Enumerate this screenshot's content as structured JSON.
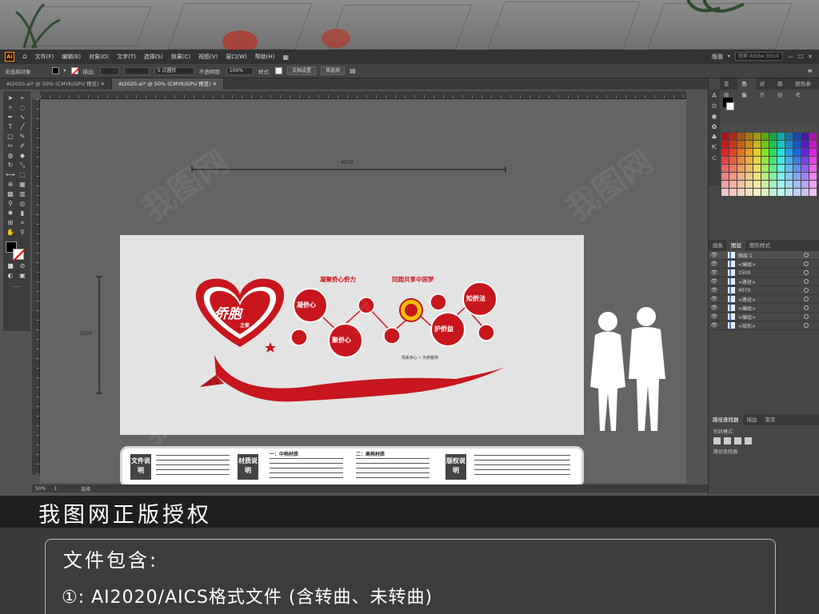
{
  "app": {
    "logo": "Ai",
    "menu": [
      "文件(F)",
      "编辑(E)",
      "对象(O)",
      "文字(T)",
      "选择(S)",
      "效果(C)",
      "视图(V)",
      "窗口(W)",
      "帮助(H)"
    ],
    "workspace": "版面",
    "search_placeholder": "搜索 Adobe Stock"
  },
  "control_bar": {
    "selection_label": "未选择对象",
    "stroke_label": "描边:",
    "brush_value": "5 点圆形",
    "opacity_label": "不透明度:",
    "opacity_value": "100%",
    "style_label": "样式:",
    "doc_setup_button": "文档设置",
    "prefs_button": "首选项"
  },
  "tabs": [
    {
      "label": "AI2020.ai* @ 50% (CMYK/GPU 预览)",
      "active": false
    },
    {
      "label": "AI2020.ai* @ 50% (CMYK/GPU 预览)",
      "active": true
    }
  ],
  "rulers": {
    "dimension_width": "4070",
    "dimension_height": "1500"
  },
  "status": {
    "zoom": "50%",
    "page": "1",
    "tool": "选择"
  },
  "panels": {
    "top_tabs": [
      "变换",
      "色板",
      "对齐",
      "路径",
      "颜色参考"
    ],
    "top_active": "色板",
    "layer_tabs": [
      "图层",
      "画板",
      "图形样式"
    ],
    "layer_active": "图层",
    "layers": [
      {
        "name": "图层 1",
        "expanded": true
      },
      {
        "name": "<编组>"
      },
      {
        "name": "1500"
      },
      {
        "name": "<路径>"
      },
      {
        "name": "4070"
      },
      {
        "name": "<路径>"
      },
      {
        "name": "<编组>"
      },
      {
        "name": "<编组>"
      },
      {
        "name": "<矩形>"
      }
    ],
    "pathfinder_tabs": [
      "路径查找器",
      "描边",
      "渐变"
    ],
    "pathfinder_active": "路径查找器",
    "shape_modes_label": "形状模式:",
    "pathfinder_label": "路径查找器:"
  },
  "design": {
    "heart_title": "侨胞",
    "heart_sub": "之家",
    "slogan_1": "凝聚侨心侨力",
    "slogan_2": "同圆共享中国梦",
    "circles": [
      "凝侨心",
      "聚侨心",
      "护侨益",
      "知侨法"
    ],
    "tagline": "情系侨心 • 为侨服务",
    "accent": "#c8161d"
  },
  "info_strip": {
    "sections": [
      {
        "label": "文件说明"
      },
      {
        "label": "材质说明",
        "heading_1": "一：中档材质",
        "heading_2": "二：高档材质"
      },
      {
        "label": "版权说明"
      }
    ]
  },
  "banner": "我图网正版授权",
  "info": {
    "title": "文件包含:",
    "line": "①: AI2020/AICS格式文件 (含转曲、未转曲)"
  },
  "watermark": "我图网"
}
